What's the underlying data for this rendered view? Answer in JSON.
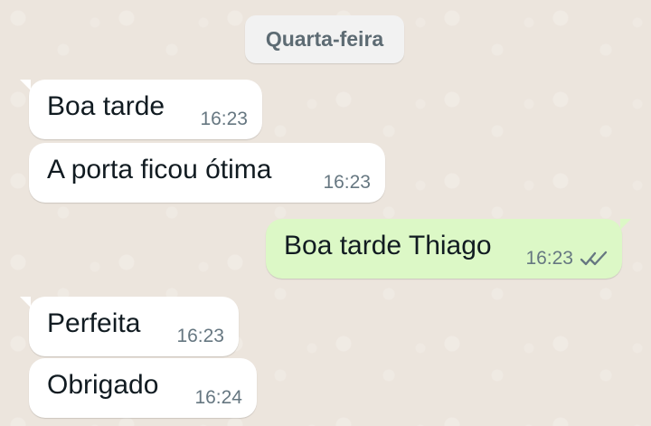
{
  "chat": {
    "date_label": "Quarta-feira",
    "messages": [
      {
        "text": "Boa tarde",
        "time": "16:23",
        "direction": "incoming"
      },
      {
        "text": "A porta ficou ótima",
        "time": "16:23",
        "direction": "incoming"
      },
      {
        "text": "Boa tarde Thiago",
        "time": "16:23",
        "direction": "outgoing",
        "status_icon": "double-check-icon"
      },
      {
        "text": "Perfeita",
        "time": "16:23",
        "direction": "incoming"
      },
      {
        "text": "Obrigado",
        "time": "16:24",
        "direction": "incoming"
      }
    ]
  },
  "colors": {
    "background": "#ece5dd",
    "incoming_bubble": "#ffffff",
    "outgoing_bubble": "#dcf8c6",
    "timestamp": "#667781",
    "date_pill": "#f2f2f2"
  }
}
